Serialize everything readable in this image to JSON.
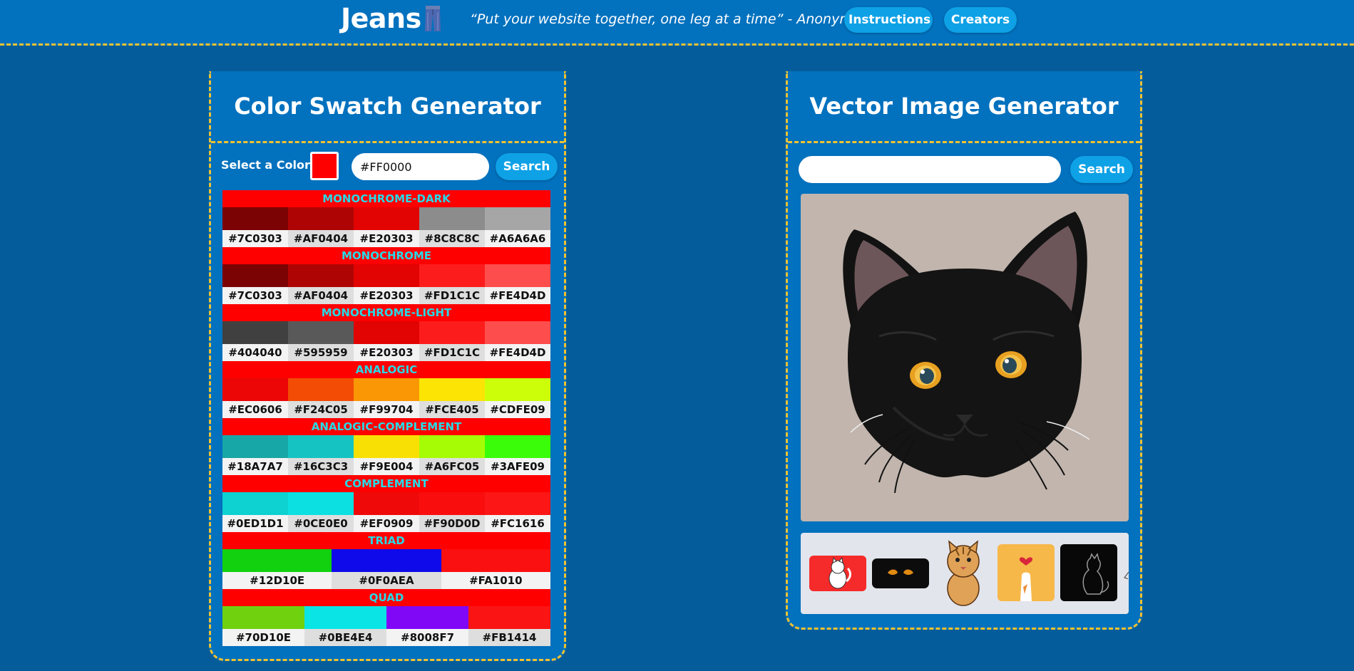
{
  "header": {
    "logo_text": "Jeans",
    "logo_icon": "jeans-icon",
    "quote": "“Put your website together, one leg at a time” - Anonymous",
    "nav": [
      {
        "label": "Instructions"
      },
      {
        "label": "Creators"
      }
    ]
  },
  "colors": {
    "page_bg": "#045d9a",
    "panel_bg": "#0271be",
    "dashed_border": "#f2c230",
    "button_bg": "#0ea1e6",
    "scheme_title_text": "#27d9e6",
    "scheme_title_bg": "#FF0000"
  },
  "swatch": {
    "title": "Color Swatch Generator",
    "select_label": "Select a Color:",
    "picker_color": "#FF0000",
    "input_value": "#FF0000",
    "search_label": "Search",
    "schemes": [
      {
        "name": "MONOCHROME-DARK",
        "colors": [
          "#7C0303",
          "#AF0404",
          "#E20303",
          "#8C8C8C",
          "#A6A6A6"
        ]
      },
      {
        "name": "MONOCHROME",
        "colors": [
          "#7C0303",
          "#AF0404",
          "#E20303",
          "#FD1C1C",
          "#FE4D4D"
        ]
      },
      {
        "name": "MONOCHROME-LIGHT",
        "colors": [
          "#404040",
          "#595959",
          "#E20303",
          "#FD1C1C",
          "#FE4D4D"
        ]
      },
      {
        "name": "ANALOGIC",
        "colors": [
          "#EC0606",
          "#F24C05",
          "#F99704",
          "#FCE405",
          "#CDFE09"
        ]
      },
      {
        "name": "ANALOGIC-COMPLEMENT",
        "colors": [
          "#18A7A7",
          "#16C3C3",
          "#F9E004",
          "#A6FC05",
          "#3AFE09"
        ]
      },
      {
        "name": "COMPLEMENT",
        "colors": [
          "#0ED1D1",
          "#0CE0E0",
          "#EF0909",
          "#F90D0D",
          "#FC1616"
        ]
      },
      {
        "name": "TRIAD",
        "colors": [
          "#12D10E",
          "#0F0AEA",
          "#FA1010"
        ]
      },
      {
        "name": "QUAD",
        "colors": [
          "#70D10E",
          "#0BE4E4",
          "#8008F7",
          "#FB1414"
        ]
      }
    ]
  },
  "vector": {
    "title": "Vector Image Generator",
    "search_value": "",
    "search_placeholder": "",
    "search_label": "Search",
    "main_image": "black-cat-illustration",
    "thumbnails": [
      {
        "name": "white-cat-red-bg"
      },
      {
        "name": "cat-eyes-dark"
      },
      {
        "name": "tabby-cat-cartoon"
      },
      {
        "name": "cat-paw-heart"
      },
      {
        "name": "black-cat-silhouette"
      }
    ]
  }
}
